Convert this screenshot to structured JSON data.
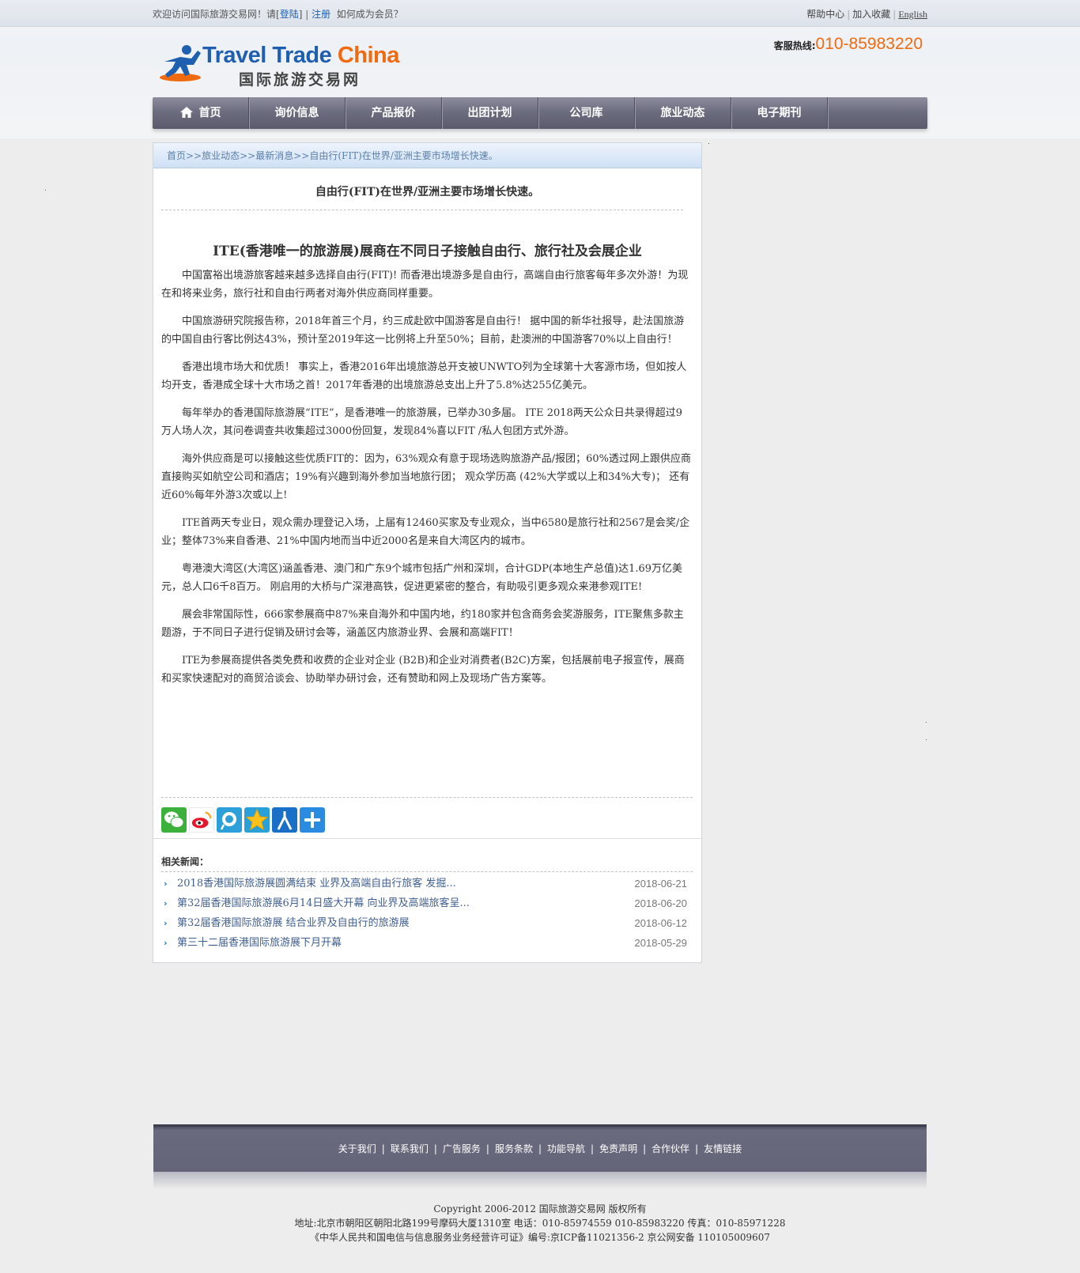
{
  "topbar": {
    "welcome_prefix": "欢迎访问国际旅游交易网！请[",
    "login": "登陆",
    "bracket_close": "]",
    "sep": "|",
    "register": "注册",
    "member_q": "如何成为会员？",
    "help": "帮助中心",
    "favorite": "加入收藏",
    "english": "English"
  },
  "logo": {
    "en_a": "Travel Trade ",
    "en_b": "China",
    "cn": "国际旅游交易网"
  },
  "hotline": {
    "label": "客服热线:",
    "number": "010-85983220"
  },
  "nav": [
    "首页",
    "询价信息",
    "产品报价",
    "出团计划",
    "公司库",
    "旅业动态",
    "电子期刊"
  ],
  "breadcrumb": "首页>>旅业动态>>最新消息>>自由行(FIT)在世界/亚洲主要市场增长快速。",
  "article": {
    "title": "自由行(FIT)在世界/亚洲主要市场增长快速。",
    "subtitle": "ITE(香港唯一的旅游展)展商在不同日子接触自由行、旅行社及会展企业",
    "paragraphs": [
      "中国富裕出境游旅客越来越多选择自由行(FIT)! 而香港出境游多是自由行，高端自由行旅客每年多次外游！为现在和将来业务，旅行社和自由行两者对海外供应商同样重要。",
      "中国旅游研究院报告称，2018年首三个月，约三成赴欧中国游客是自由行！ 据中国的新华社报导，赴法国旅游的中国自由行客比例达43%，预计至2019年这一比例将上升至50%；目前，赴澳洲的中国游客70%以上自由行！",
      "香港出境市场大和优质！ 事实上，香港2016年出境旅游总开支被UNWTO列为全球第十大客源市场，但如按人均开支，香港成全球十大市场之首！2017年香港的出境旅游总支出上升了5.8%达255亿美元。",
      "每年举办的香港国际旅游展“ITE”，是香港唯一的旅游展，已举办30多届。 ITE 2018两天公众日共录得超过9万人场人次，其问卷调查共收集超过3000份回复，发现84%喜以FIT /私人包团方式外游。",
      "海外供应商是可以接触这些优质FIT的：因为，63%观众有意于现场选购旅游产品/报团；60%透过网上跟供应商直接购买如航空公司和酒店；19%有兴趣到海外参加当地旅行团； 观众学历高 (42%大学或以上和34%大专)； 还有近60%每年外游3次或以上!",
      "ITE首两天专业日，观众需办理登记入场，上届有12460买家及专业观众，当中6580是旅行社和2567是会奖/企业；整体73%来自香港、21%中国内地而当中近2000名是来自大湾区内的城市。",
      "粤港澳大湾区(大湾区)涵盖香港、澳门和广东9个城市包括广州和深圳，合计GDP(本地生产总值)达1.69万亿美元，总人口6千8百万。 刚启用的大桥与广深港高铁，促进更紧密的整合，有助吸引更多观众来港参观ITE!",
      "展会非常国际性，666家参展商中87%来自海外和中国内地，约180家并包含商务会奖游服务，ITE聚焦多款主题游，于不同日子进行促销及研讨会等，涵盖区内旅游业界、会展和高端FIT！",
      "ITE为参展商提供各类免费和收费的企业对企业 (B2B)和企业对消费者(B2C)方案，包括展前电子报宣传，展商和买家快速配对的商贸洽谈会、协助举办研讨会，还有赞助和网上及现场广告方案等。"
    ]
  },
  "share_icons": [
    "wechat-icon",
    "weibo-icon",
    "tencent-weibo-icon",
    "qzone-icon",
    "renren-icon",
    "more-share-icon"
  ],
  "related": {
    "heading": "相关新闻：",
    "items": [
      {
        "title": "2018香港国际旅游展圆满结束 业界及高端自由行旅客 发掘...",
        "date": "2018-06-21"
      },
      {
        "title": "第32届香港国际旅游展6月14日盛大开幕 向业界及高端旅客呈...",
        "date": "2018-06-20"
      },
      {
        "title": "第32届香港国际旅游展 结合业界及自由行的旅游展",
        "date": "2018-06-12"
      },
      {
        "title": "第三十二届香港国际旅游展下月开幕",
        "date": "2018-05-29"
      }
    ]
  },
  "footer": {
    "links": [
      "关于我们",
      "联系我们",
      "广告服务",
      "服务条款",
      "功能导航",
      "免责声明",
      "合作伙伴",
      "友情链接"
    ],
    "link_sep": "|",
    "copyright": "Copyright 2006-2012 国际旅游交易网 版权所有",
    "address": "地址:北京市朝阳区朝阳北路199号摩码大厦1310室 电话：010-85974559 010-85983220 传真：010-85971228",
    "license": "《中华人民共和国电信与信息服务业务经营许可证》编号:京ICP备11021356-2 京公网安备 110105009607"
  },
  "colors": {
    "accent_orange": "#f06a10",
    "brand_blue": "#1e5fb0",
    "nav_bg": "#6d6d80",
    "link_blue": "#3f5f8f"
  }
}
